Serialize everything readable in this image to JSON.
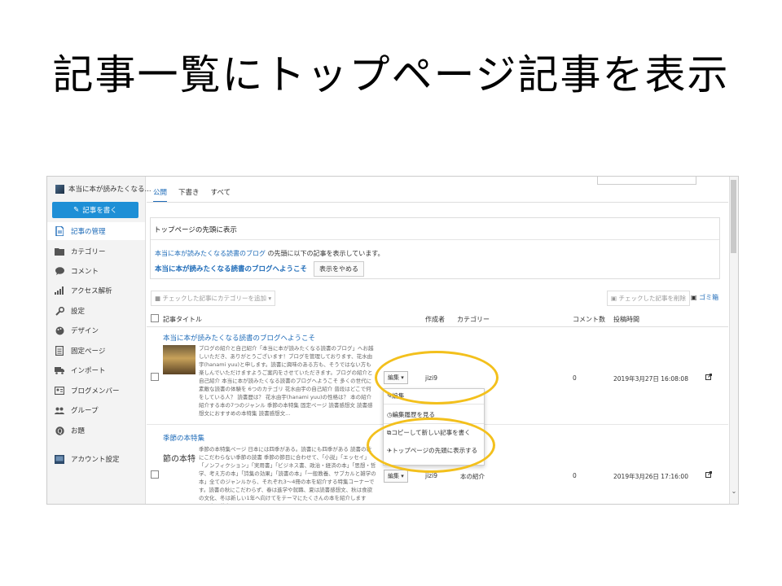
{
  "slide": {
    "title": "記事一覧にトップページ記事を表示"
  },
  "sidebar": {
    "blog_name": "本当に本が読みたくなる...",
    "write_button": "記事を書く",
    "items": [
      {
        "label": "記事の管理",
        "icon": "document-icon"
      },
      {
        "label": "カテゴリー",
        "icon": "folder-icon"
      },
      {
        "label": "コメント",
        "icon": "comment-icon"
      },
      {
        "label": "アクセス解析",
        "icon": "bar-chart-icon"
      },
      {
        "label": "設定",
        "icon": "wrench-icon"
      },
      {
        "label": "デザイン",
        "icon": "palette-icon"
      },
      {
        "label": "固定ページ",
        "icon": "page-icon"
      },
      {
        "label": "インポート",
        "icon": "truck-icon"
      },
      {
        "label": "ブログメンバー",
        "icon": "member-card-icon"
      },
      {
        "label": "グループ",
        "icon": "group-icon"
      },
      {
        "label": "お題",
        "icon": "question-icon"
      },
      {
        "label": "アカウント設定",
        "icon": "account-icon"
      }
    ]
  },
  "tabs": [
    "公開",
    "下書き",
    "すべて"
  ],
  "top_panel": {
    "title": "トップページの先頭に表示",
    "desc_link": "本当に本が読みたくなる読書のブログ",
    "desc_rest": " の先頭に以下の記事を表示しています。",
    "post_link": "本当に本が読みたくなる読書のブログへようこそ",
    "stop_button": "表示をやめる"
  },
  "toolbar": {
    "add_category": "チェックした記事にカテゴリーを追加",
    "delete_checked": "チェックした記事を削除",
    "trash": "ゴミ箱"
  },
  "table": {
    "headers": {
      "title": "記事タイトル",
      "author": "作成者",
      "category": "カテゴリー",
      "comments": "コメント数",
      "date": "投稿時間"
    },
    "rows": [
      {
        "title": "本当に本が読みたくなる読書のブログへようこそ",
        "excerpt": "ブログの紹介と自己紹介「本当に本が読みたくなる読書のブログ」へお越しいただき、ありがとうございます！ブログを管理しております、花水由宇(hanami yuu)と申します。読書に興味のある方も、そうではない方も楽しんでいただけますようご案内をさせていただきます。ブログの紹介と自己紹介 本当に本が読みたくなる読書のブログへようこそ 多くの世代に素敵な読書の体験を 6つのカテゴリ 花水由宇の自己紹介 普段はどこで何をしている人？ 読書歴は？ 花水由宇(hanami yuu)の性格は？ 本の紹介 紹介する本の7つのジャンル 季節の本特集 固定ページ 読書感想文 読書感想文におすすめの本特集 読書感想文...",
        "edit": "編集",
        "author": "jizi9",
        "category": "",
        "comments": "0",
        "date": "2019年3月27日 16:08:08"
      },
      {
        "title": "季節の本特集",
        "thumb_text": "節の本特",
        "excerpt": "季節の本特集ページ 日本には四季がある。読書にも四季がある 読書の秋にこだわらない季節の読書 季節の節目に合わせて、「小説」「エッセイ」「ノンフィクション」「実用書」「ビジネス書、政治・経済の本」「思想・哲学、考え方の本」「詩集の効果」「読書の本」「一般教養、サブカルと雑学の本」全てのジャンルから、それぞれ3～4冊の本を紹介する特集コーナーです。読書の秋にこだわらず、春は進学や就職、夏は読書感想文、秋は食欲の文化、冬は新しい1年へ向けてをテーマにたくさんの本を紹介しますね。春夏秋冬～",
        "edit": "編集",
        "author": "jizi9",
        "category": "本の紹介",
        "comments": "0",
        "date": "2019年3月26日 17:16:00"
      }
    ]
  },
  "dropdown": {
    "items": [
      "編集",
      "編集履歴を見る",
      "コピーして新しい記事を書く",
      "トップページの先頭に表示する"
    ]
  },
  "colors": {
    "accent": "#1e6bb8",
    "write_button": "#1e8fd6",
    "highlight": "#f3c01c"
  }
}
